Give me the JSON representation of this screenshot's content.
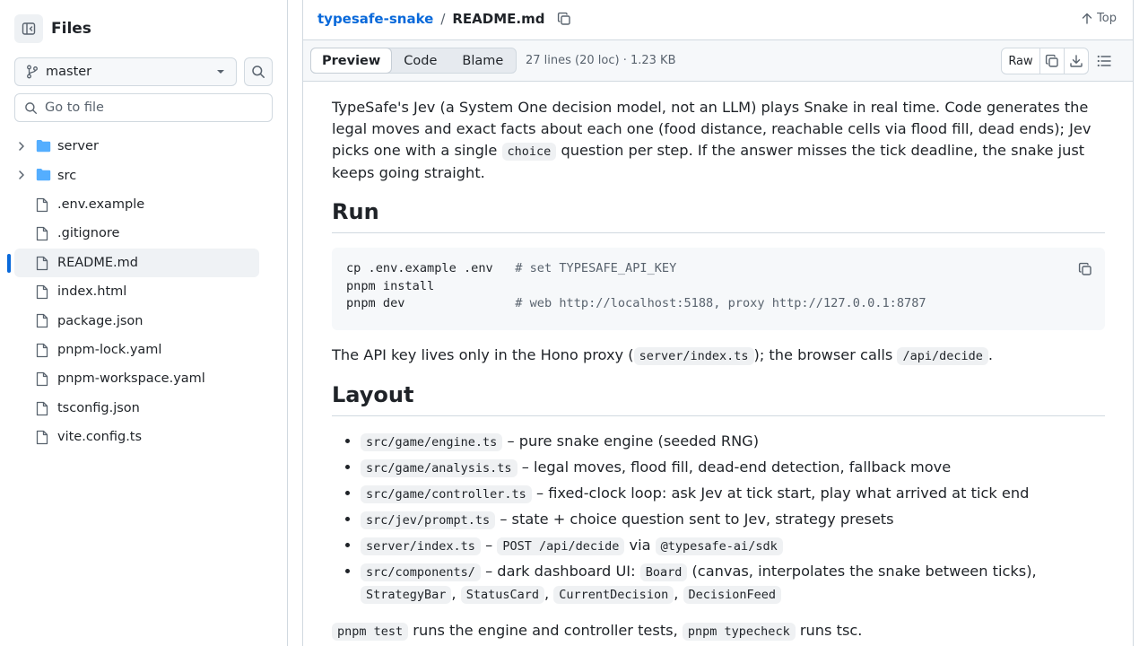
{
  "sidebar": {
    "title": "Files",
    "branch": "master",
    "goto_placeholder": "Go to file",
    "items": [
      {
        "label": "server",
        "type": "folder"
      },
      {
        "label": "src",
        "type": "folder"
      },
      {
        "label": ".env.example",
        "type": "file"
      },
      {
        "label": ".gitignore",
        "type": "file"
      },
      {
        "label": "README.md",
        "type": "file",
        "selected": true
      },
      {
        "label": "index.html",
        "type": "file"
      },
      {
        "label": "package.json",
        "type": "file"
      },
      {
        "label": "pnpm-lock.yaml",
        "type": "file"
      },
      {
        "label": "pnpm-workspace.yaml",
        "type": "file"
      },
      {
        "label": "tsconfig.json",
        "type": "file"
      },
      {
        "label": "vite.config.ts",
        "type": "file"
      }
    ]
  },
  "header": {
    "repo": "typesafe-snake",
    "separator": "/",
    "file": "README.md",
    "top_label": "Top"
  },
  "toolbar": {
    "tabs": [
      "Preview",
      "Code",
      "Blame"
    ],
    "active_tab": "Preview",
    "file_info": "27 lines (20 loc) · 1.23 KB",
    "raw_label": "Raw"
  },
  "readme": {
    "intro_part1": "TypeSafe's Jev (a System One decision model, not an LLM) plays Snake in real time. Code generates the legal moves and exact facts about each one (food distance, reachable cells via flood fill, dead ends); Jev picks one with a single ",
    "intro_code": "choice",
    "intro_part2": " question per step. If the answer misses the tick deadline, the snake just keeps going straight.",
    "run_heading": "Run",
    "code_lines": [
      {
        "cmd": "cp .env.example .env   ",
        "comment": "# set TYPESAFE_API_KEY"
      },
      {
        "cmd": "pnpm install",
        "comment": ""
      },
      {
        "cmd": "pnpm dev               ",
        "comment": "# web http://localhost:5188, proxy http://127.0.0.1:8787"
      }
    ],
    "api_part1": "The API key lives only in the Hono proxy (",
    "api_code1": "server/index.ts",
    "api_part2": "); the browser calls ",
    "api_code2": "/api/decide",
    "api_part3": ".",
    "layout_heading": "Layout",
    "layout_items": [
      {
        "code": "src/game/engine.ts",
        "text": " – pure snake engine (seeded RNG)"
      },
      {
        "code": "src/game/analysis.ts",
        "text": " – legal moves, flood fill, dead-end detection, fallback move"
      },
      {
        "code": "src/game/controller.ts",
        "text": " – fixed-clock loop: ask Jev at tick start, play what arrived at tick end"
      },
      {
        "code": "src/jev/prompt.ts",
        "text": " – state + choice question sent to Jev, strategy presets"
      }
    ],
    "server_item": {
      "code": "server/index.ts",
      "dash": " – ",
      "code2": "POST /api/decide",
      "via": " via ",
      "code3": "@typesafe-ai/sdk"
    },
    "components_item": {
      "code": "src/components/",
      "text1": " – dark dashboard UI: ",
      "board": "Board",
      "text2": " (canvas, interpolates the snake between ticks),",
      "c1": "StrategyBar",
      "c2": "StatusCard",
      "c3": "CurrentDecision",
      "c4": "DecisionFeed",
      "comma": ", "
    },
    "test_code": "pnpm test",
    "test_text1": " runs the engine and controller tests, ",
    "typecheck_code": "pnpm typecheck",
    "test_text2": " runs tsc."
  }
}
